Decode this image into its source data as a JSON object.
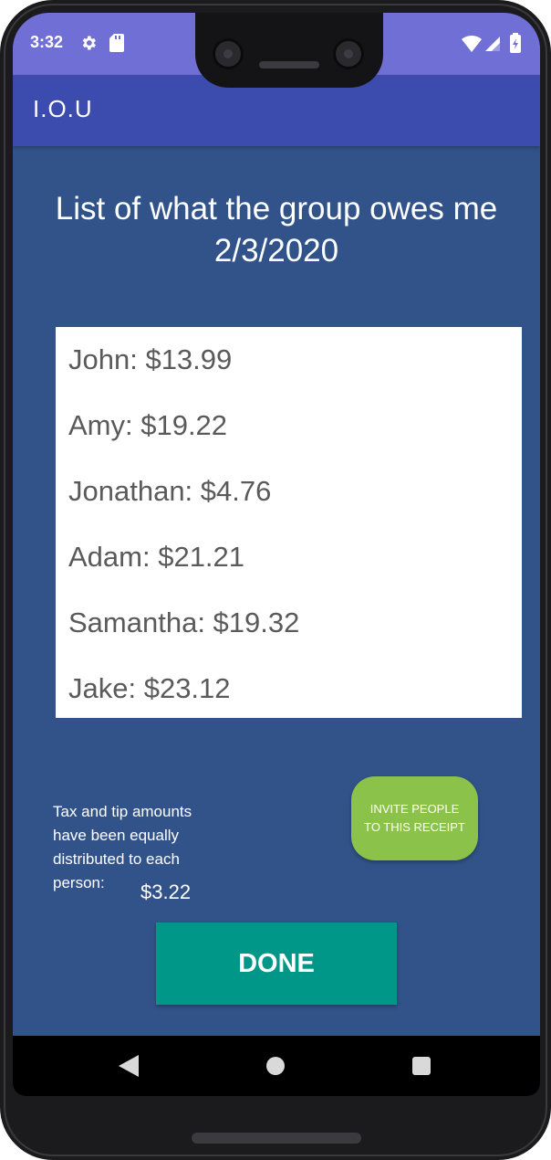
{
  "status_bar": {
    "time": "3:32",
    "icons": [
      "gear-icon",
      "sd-card-icon",
      "wifi-icon",
      "signal-icon",
      "battery-icon"
    ]
  },
  "app_bar": {
    "title": "I.O.U"
  },
  "heading": {
    "line1": "List of what the group owes me",
    "line2": "2/3/2020"
  },
  "owed_list": [
    {
      "text": "John: $13.99"
    },
    {
      "text": "Amy: $19.22"
    },
    {
      "text": "Jonathan: $4.76"
    },
    {
      "text": "Adam: $21.21"
    },
    {
      "text": "Samantha: $19.32"
    },
    {
      "text": "Jake: $23.12"
    }
  ],
  "tax_note": {
    "text": "Tax and tip amounts have been equally distributed to each person:",
    "amount": "$3.22"
  },
  "invite_button": {
    "label": "INVITE PEOPLE TO THIS RECEIPT"
  },
  "done_button": {
    "label": "DONE"
  },
  "nav_bar": {
    "icons": [
      "back-icon",
      "home-icon",
      "recent-apps-icon"
    ]
  },
  "colors": {
    "status_bar": "#6f6fd6",
    "app_bar": "#3b4cae",
    "background": "#315389",
    "invite_button": "#8bc34a",
    "done_button": "#009688"
  }
}
